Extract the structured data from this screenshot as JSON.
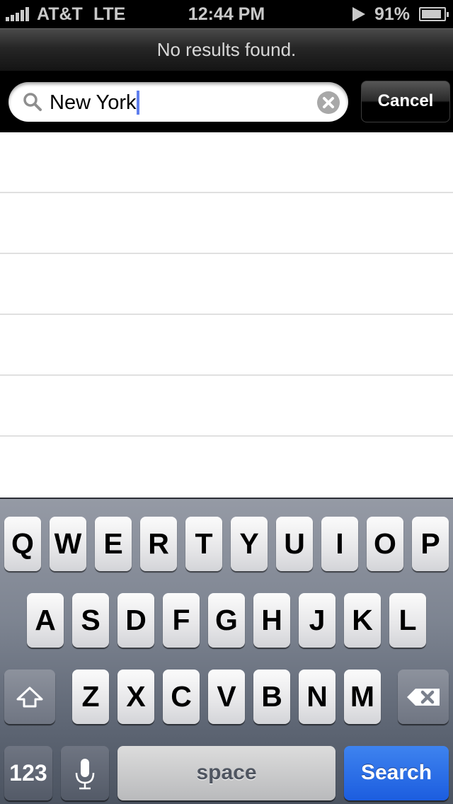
{
  "status_bar": {
    "carrier": "AT&T",
    "network": "LTE",
    "time": "12:44 PM",
    "battery_percent": "91%",
    "battery_level": 0.91,
    "signal_bars": 5
  },
  "header": {
    "message": "No results found."
  },
  "search": {
    "query": "New York",
    "cancel_label": "Cancel"
  },
  "results": {
    "rows": [
      "",
      "",
      "",
      "",
      "",
      ""
    ]
  },
  "keyboard": {
    "row1": [
      "Q",
      "W",
      "E",
      "R",
      "T",
      "Y",
      "U",
      "I",
      "O",
      "P"
    ],
    "row2": [
      "A",
      "S",
      "D",
      "F",
      "G",
      "H",
      "J",
      "K",
      "L"
    ],
    "row3": [
      "Z",
      "X",
      "C",
      "V",
      "B",
      "N",
      "M"
    ],
    "numbers_label": "123",
    "space_label": "space",
    "return_label": "Search",
    "colors": {
      "return_key": "#2a6de6",
      "caret": "#5f7fee"
    }
  }
}
